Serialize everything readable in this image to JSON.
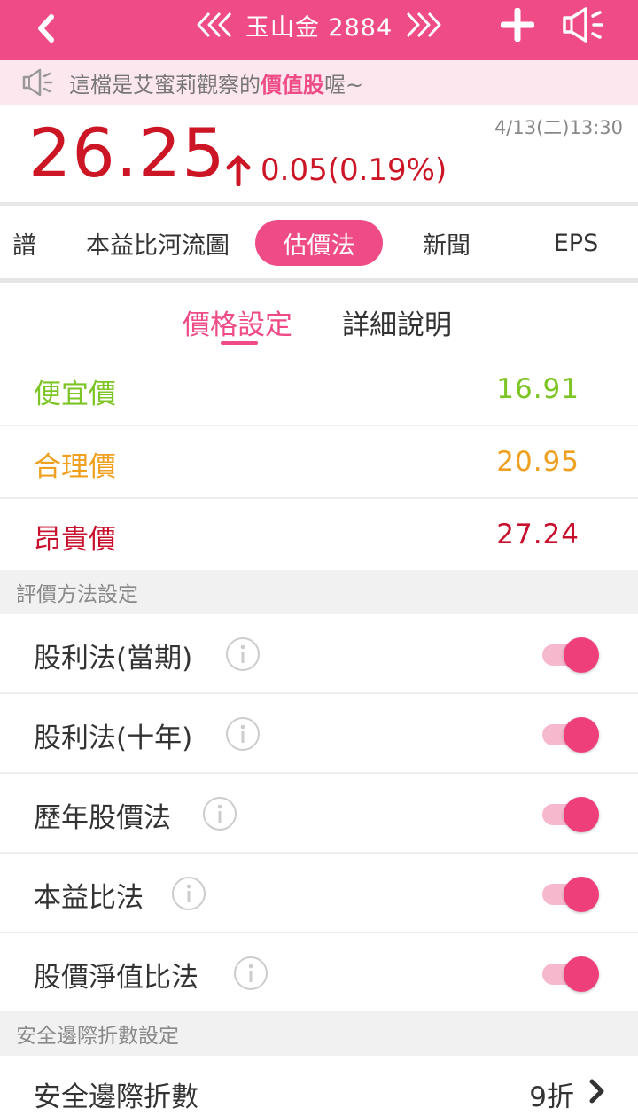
{
  "header": {
    "title": "玉山金 2884",
    "accent_color": "#ee4b87",
    "icons": [
      "back-icon",
      "prev-stock-icon",
      "next-stock-icon",
      "plus-icon",
      "speaker-icon"
    ]
  },
  "notice": {
    "text_before": "這檔是艾蜜莉觀察的",
    "highlight": "價值股",
    "text_after": "喔~"
  },
  "quote": {
    "price": "26.25",
    "change": "0.05(0.19%)",
    "timestamp": "4/13(二)13:30",
    "up_color": "#cc1525"
  },
  "tabs": [
    {
      "label": "譜",
      "active": false
    },
    {
      "label": "本益比河流圖",
      "active": false
    },
    {
      "label": "估價法",
      "active": true
    },
    {
      "label": "新聞",
      "active": false
    },
    {
      "label": "EPS",
      "active": false
    }
  ],
  "subtabs": [
    {
      "label": "價格設定",
      "active": true
    },
    {
      "label": "詳細說明",
      "active": false
    }
  ],
  "prices": [
    {
      "label": "便宜價",
      "value": "16.91",
      "color": "#7dc425"
    },
    {
      "label": "合理價",
      "value": "20.95",
      "color": "#f0a020"
    },
    {
      "label": "昂貴價",
      "value": "27.24",
      "color": "#c8102e"
    }
  ],
  "method_section_title": "評價方法設定",
  "methods": [
    {
      "label": "股利法(當期)",
      "enabled": true
    },
    {
      "label": "股利法(十年)",
      "enabled": true
    },
    {
      "label": "歷年股價法",
      "enabled": true
    },
    {
      "label": "本益比法",
      "enabled": true
    },
    {
      "label": "股價淨值比法",
      "enabled": true
    }
  ],
  "margin_section_title": "安全邊際折數設定",
  "margin": {
    "label": "安全邊際折數",
    "value": "9折"
  }
}
